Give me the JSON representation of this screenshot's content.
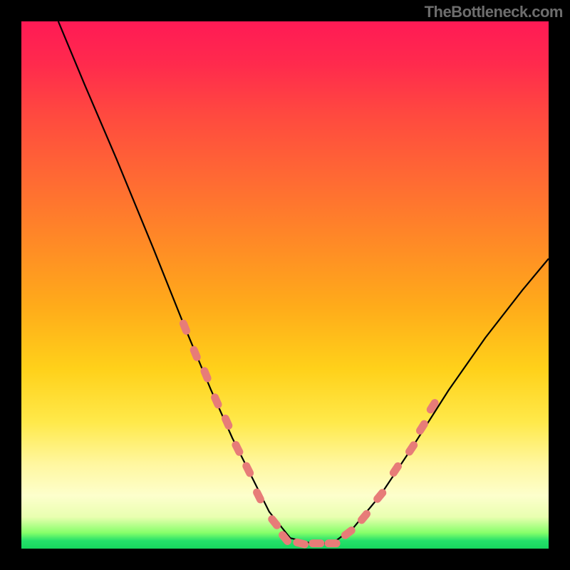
{
  "watermark": "TheBottleneck.com",
  "chart_data": {
    "type": "line",
    "title": "",
    "xlabel": "",
    "ylabel": "",
    "xlim": [
      0,
      100
    ],
    "ylim": [
      0,
      100
    ],
    "series": [
      {
        "name": "curve",
        "x": [
          7,
          12,
          18,
          25,
          31,
          36,
          40,
          44,
          47,
          51,
          55,
          59,
          63,
          68,
          74,
          81,
          88,
          95,
          100
        ],
        "values": [
          100,
          88,
          74,
          57,
          42,
          30,
          21,
          13,
          7,
          2,
          1,
          1,
          4,
          10,
          19,
          30,
          40,
          49,
          55
        ]
      }
    ],
    "markers": {
      "name": "dash-segments",
      "color": "#e77c78",
      "points": [
        {
          "x": 31,
          "y": 42
        },
        {
          "x": 33,
          "y": 37
        },
        {
          "x": 35,
          "y": 33
        },
        {
          "x": 37,
          "y": 28
        },
        {
          "x": 39,
          "y": 24
        },
        {
          "x": 41,
          "y": 19
        },
        {
          "x": 43,
          "y": 15
        },
        {
          "x": 45,
          "y": 10
        },
        {
          "x": 48,
          "y": 5
        },
        {
          "x": 50,
          "y": 2
        },
        {
          "x": 53,
          "y": 1
        },
        {
          "x": 56,
          "y": 1
        },
        {
          "x": 59,
          "y": 1
        },
        {
          "x": 62,
          "y": 3
        },
        {
          "x": 65,
          "y": 6
        },
        {
          "x": 68,
          "y": 10
        },
        {
          "x": 71,
          "y": 15
        },
        {
          "x": 74,
          "y": 19
        },
        {
          "x": 76,
          "y": 23
        },
        {
          "x": 78,
          "y": 27
        }
      ]
    }
  }
}
